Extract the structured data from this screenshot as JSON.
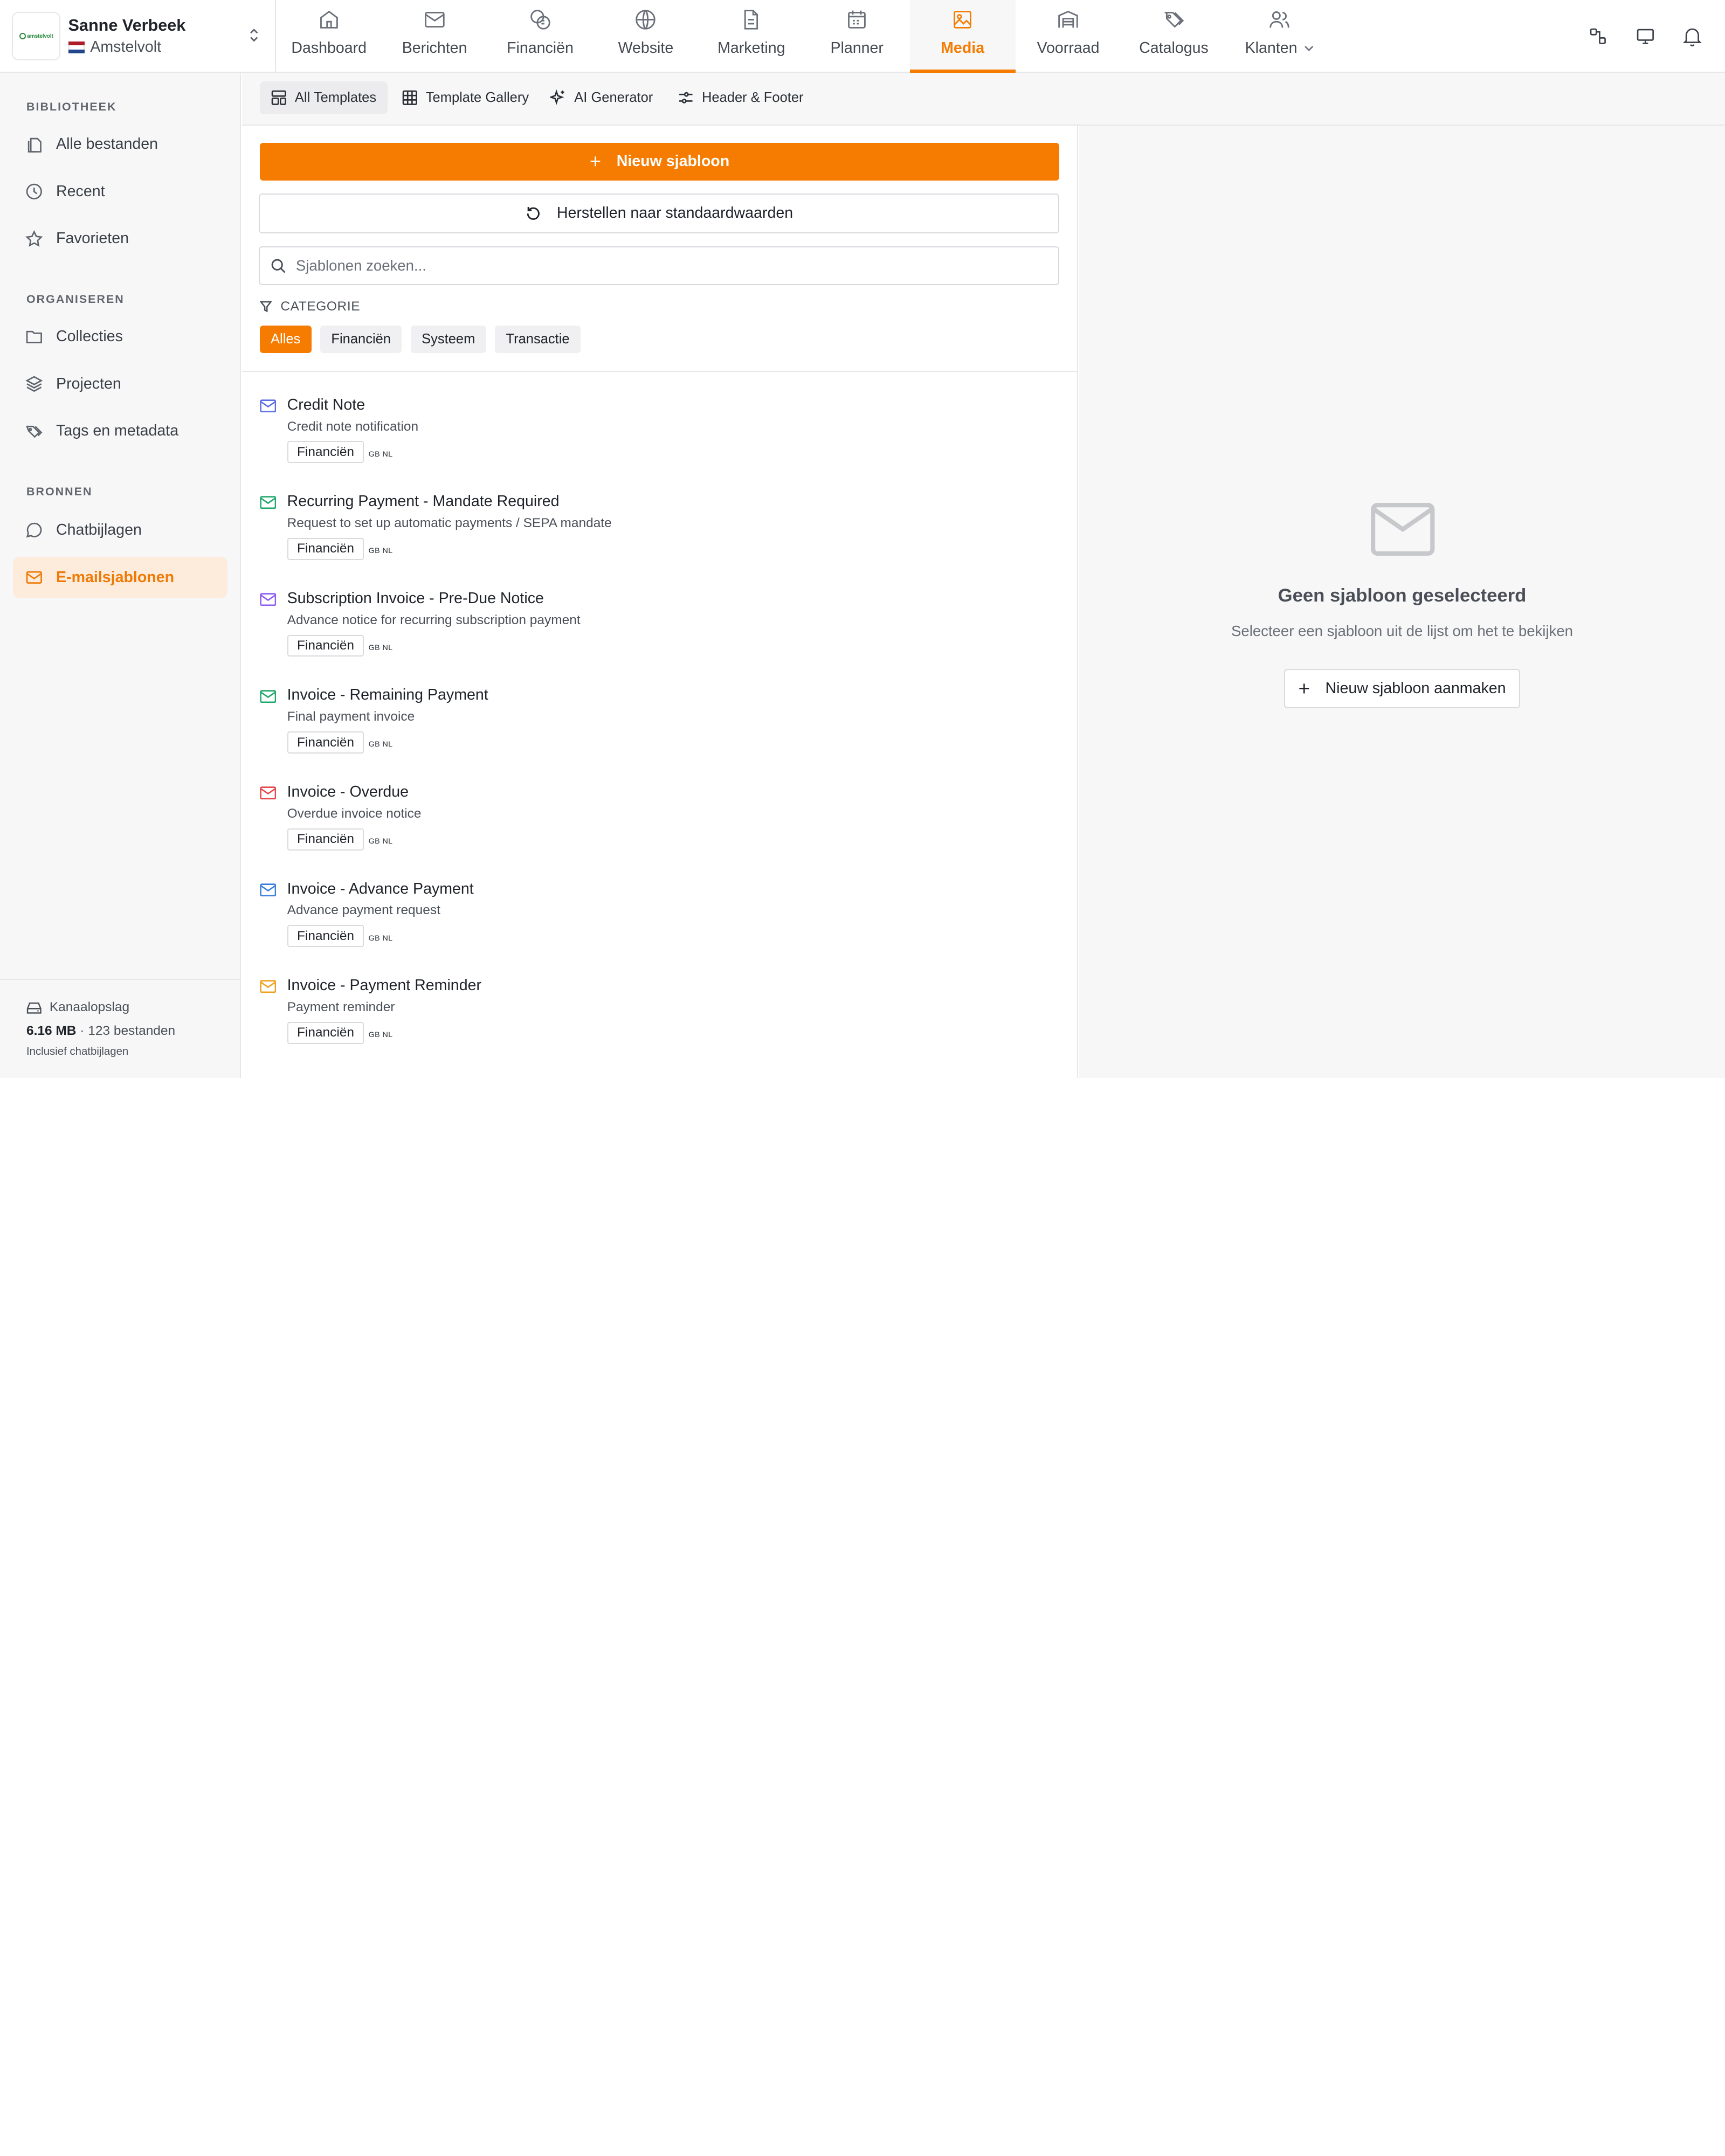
{
  "account": {
    "name": "Sanne Verbeek",
    "company": "Amstelvolt",
    "logo_text": "amstelvolt"
  },
  "nav": {
    "items": [
      {
        "label": "Dashboard",
        "icon": "home-icon"
      },
      {
        "label": "Berichten",
        "icon": "mail-icon"
      },
      {
        "label": "Financiën",
        "icon": "coins-icon"
      },
      {
        "label": "Website",
        "icon": "globe-icon"
      },
      {
        "label": "Marketing",
        "icon": "document-icon"
      },
      {
        "label": "Planner",
        "icon": "calendar-icon"
      },
      {
        "label": "Media",
        "icon": "image-icon"
      },
      {
        "label": "Voorraad",
        "icon": "warehouse-icon"
      },
      {
        "label": "Catalogus",
        "icon": "tags-icon"
      },
      {
        "label": "Klanten",
        "icon": "users-icon"
      }
    ],
    "active": "Media",
    "accent": "#f57c00"
  },
  "sidebar": {
    "sections": [
      {
        "title": "BIBLIOTHEEK",
        "items": [
          "Alle bestanden",
          "Recent",
          "Favorieten"
        ]
      },
      {
        "title": "ORGANISEREN",
        "items": [
          "Collecties",
          "Projecten",
          "Tags en metadata"
        ]
      },
      {
        "title": "BRONNEN",
        "items": [
          "Chatbijlagen",
          "E-mailsjablonen"
        ]
      }
    ],
    "active_item": "E-mailsjablonen",
    "storage": {
      "title": "Kanaalopslag",
      "size": "6.16 MB",
      "files": "· 123 bestanden",
      "note": "Inclusief chatbijlagen"
    }
  },
  "subtabs": [
    "All Templates",
    "Template Gallery",
    "AI Generator",
    "Header & Footer"
  ],
  "list": {
    "new_button": "Nieuw sjabloon",
    "reset_button": "Herstellen naar standaardwaarden",
    "search_placeholder": "Sjablonen zoeken...",
    "category_label": "CATEGORIE",
    "chips": [
      "Alles",
      "Financiën",
      "Systeem",
      "Transactie"
    ],
    "active_chip": "Alles",
    "templates": [
      {
        "title": "Credit Note",
        "desc": "Credit note notification",
        "tag": "Financiën",
        "lang": "GB NL",
        "color": "#5b6ee8"
      },
      {
        "title": "Recurring Payment - Mandate Required",
        "desc": "Request to set up automatic payments / SEPA mandate",
        "tag": "Financiën",
        "lang": "GB NL",
        "color": "#20a86b"
      },
      {
        "title": "Subscription Invoice - Pre-Due Notice",
        "desc": "Advance notice for recurring subscription payment",
        "tag": "Financiën",
        "lang": "GB NL",
        "color": "#8b5cf6"
      },
      {
        "title": "Invoice - Remaining Payment",
        "desc": "Final payment invoice",
        "tag": "Financiën",
        "lang": "GB NL",
        "color": "#20a86b"
      },
      {
        "title": "Invoice - Overdue",
        "desc": "Overdue invoice notice",
        "tag": "Financiën",
        "lang": "GB NL",
        "color": "#e5484d"
      },
      {
        "title": "Invoice - Advance Payment",
        "desc": "Advance payment request",
        "tag": "Financiën",
        "lang": "GB NL",
        "color": "#3b7ddd"
      },
      {
        "title": "Invoice - Payment Reminder",
        "desc": "Payment reminder",
        "tag": "Financiën",
        "lang": "GB NL",
        "color": "#f0a020"
      }
    ]
  },
  "preview": {
    "empty_title": "Geen sjabloon geselecteerd",
    "empty_sub": "Selecteer een sjabloon uit de lijst om het te bekijken",
    "create_button": "Nieuw sjabloon aanmaken"
  }
}
